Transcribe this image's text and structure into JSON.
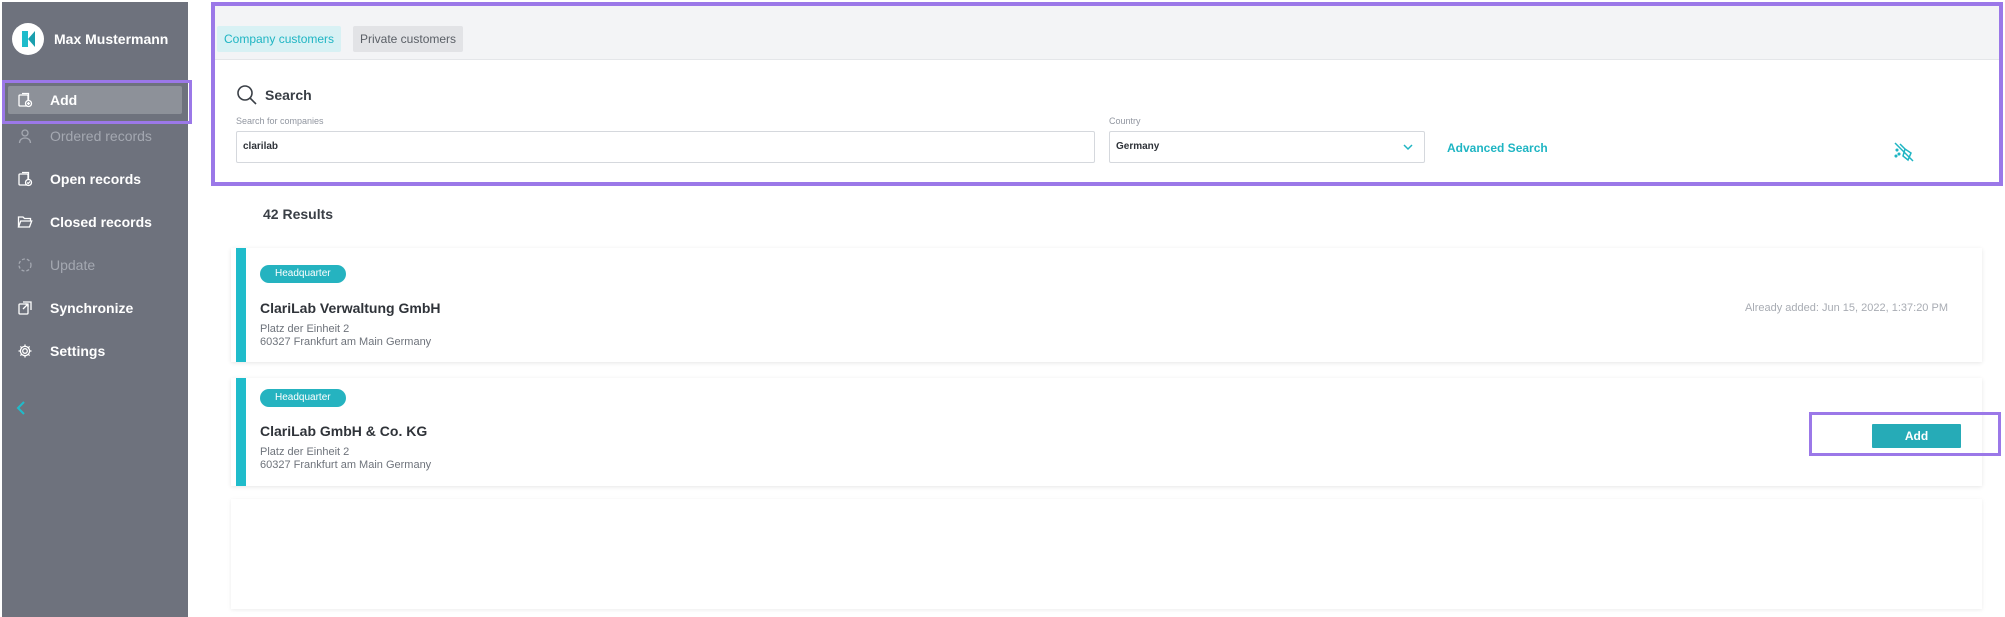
{
  "user": {
    "name": "Max Mustermann"
  },
  "sidebar": {
    "items": [
      {
        "label": "Add",
        "icon": "add-record-icon",
        "state": "active"
      },
      {
        "label": "Ordered records",
        "icon": "person-icon",
        "state": "disabled"
      },
      {
        "label": "Open records",
        "icon": "open-records-icon",
        "state": "normal"
      },
      {
        "label": "Closed records",
        "icon": "folder-open-icon",
        "state": "normal"
      },
      {
        "label": "Update",
        "icon": "sync-circle-icon",
        "state": "disabled"
      },
      {
        "label": "Synchronize",
        "icon": "synchronize-icon",
        "state": "normal"
      },
      {
        "label": "Settings",
        "icon": "gear-icon",
        "state": "normal"
      }
    ],
    "collapse_icon": "chevron-left-icon"
  },
  "tabs": {
    "company": "Company customers",
    "private": "Private customers"
  },
  "search": {
    "title": "Search",
    "company_label": "Search for companies",
    "company_value": "clarilab",
    "country_label": "Country",
    "country_value": "Germany",
    "advanced_link": "Advanced Search",
    "clear_icon": "clear-filter-icon"
  },
  "results": {
    "count_text": "42 Results",
    "items": [
      {
        "badge": "Headquarter",
        "name": "ClariLab Verwaltung GmbH",
        "street": "Platz der Einheit 2",
        "city": "60327 Frankfurt am Main Germany",
        "status": "Already added:  Jun 15, 2022, 1:37:20 PM"
      },
      {
        "badge": "Headquarter",
        "name": "ClariLab GmbH & Co. KG",
        "street": "Platz der Einheit 2",
        "city": "60327 Frankfurt am Main Germany",
        "action": "Add"
      }
    ]
  },
  "colors": {
    "accent": "#1fb5c3",
    "sidebar": "#6e727d",
    "highlight": "#9b78e8"
  }
}
